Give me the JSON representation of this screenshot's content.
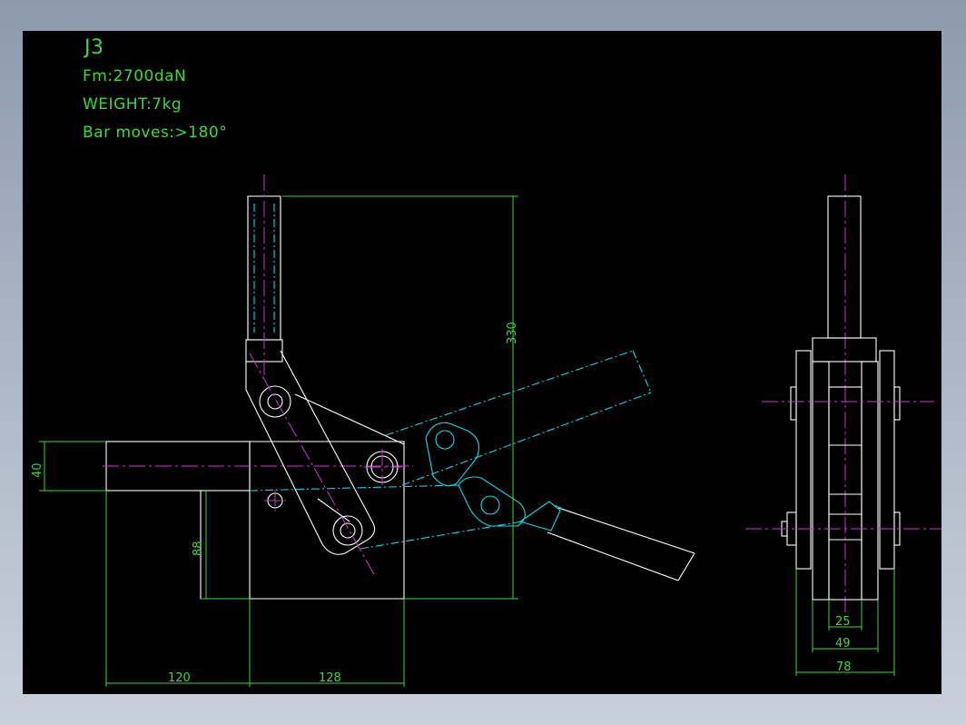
{
  "notes": {
    "model": "J3",
    "force": "Fm:2700daN",
    "weight": "WEIGHT:7kg",
    "bar_moves": "Bar moves:>180°"
  },
  "dimensions": {
    "overall_height": "330",
    "bar_height": "40",
    "base_height": "88",
    "bar_length": "120",
    "base_length": "128",
    "width_inner": "25",
    "width_mid": "49",
    "width_outer": "78"
  },
  "colors": {
    "background": "#000000",
    "geometry": "#ffffff",
    "dimension": "#3fd63f",
    "centerline": "#c83ac8",
    "alternate_position": "#22cfe0"
  }
}
